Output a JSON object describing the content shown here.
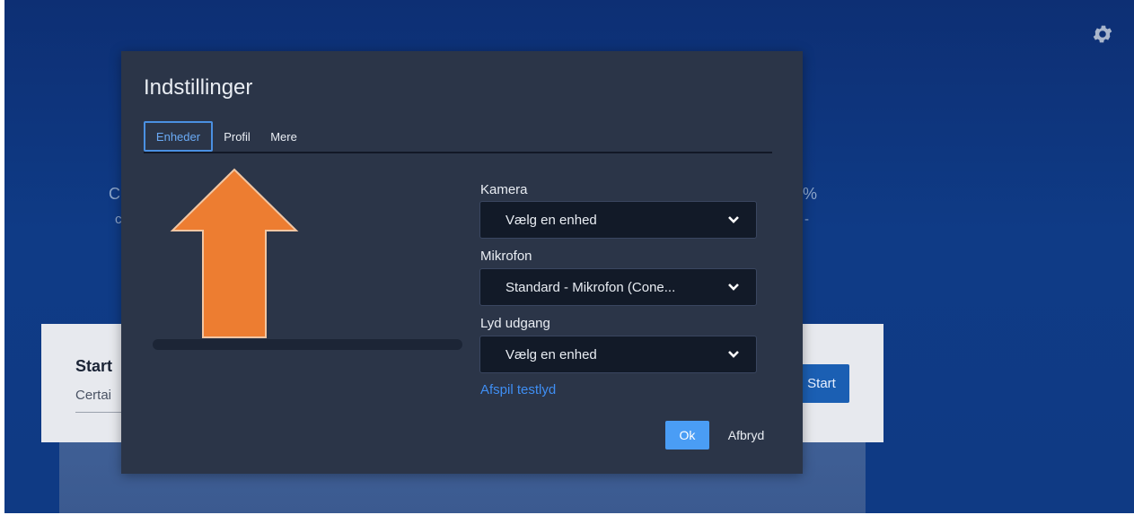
{
  "background": {
    "card_title": "Start",
    "card_subtitle": "Certai",
    "start_button": "Start",
    "partial_left_1": "C",
    "partial_left_2": "c",
    "partial_right_1": "%",
    "partial_right_2": "-"
  },
  "modal": {
    "title": "Indstillinger",
    "tabs": [
      {
        "label": "Enheder",
        "active": true
      },
      {
        "label": "Profil",
        "active": false
      },
      {
        "label": "Mere",
        "active": false
      }
    ],
    "camera": {
      "label": "Kamera",
      "value": "Vælg en enhed"
    },
    "microphone": {
      "label": "Mikrofon",
      "value": "Standard - Mikrofon (Cone..."
    },
    "audio_output": {
      "label": "Lyd udgang",
      "value": "Vælg en enhed"
    },
    "test_sound_link": "Afspil testlyd",
    "ok_button": "Ok",
    "cancel_button": "Afbryd"
  },
  "icons": {
    "settings": "gear-icon",
    "dropdown": "chevron-down-icon",
    "annotation": "arrow-up-icon"
  },
  "colors": {
    "accent": "#4a90e2",
    "link": "#3f8ef3",
    "annotation_arrow": "#ed7d31",
    "modal_bg": "#2b3548"
  }
}
